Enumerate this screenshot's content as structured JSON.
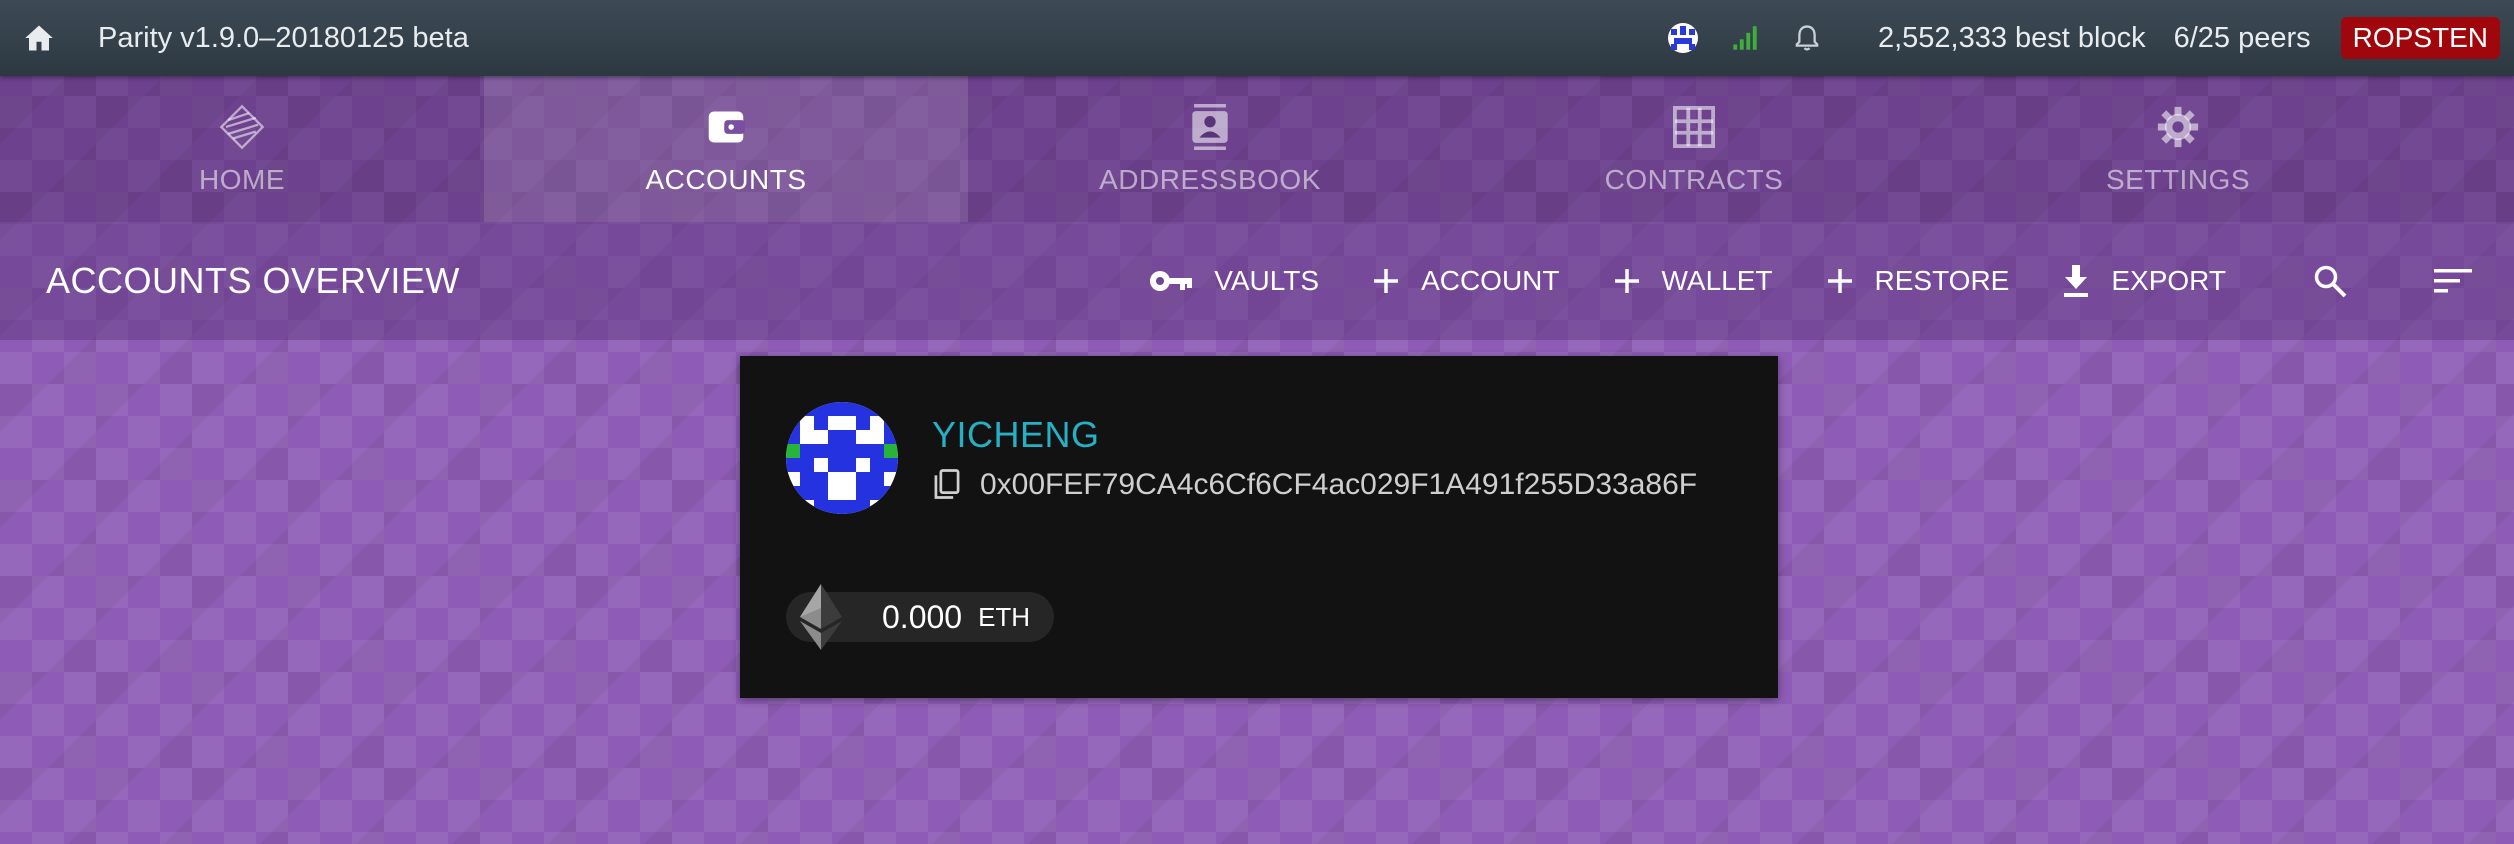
{
  "status_bar": {
    "app_title": "Parity v1.9.0–20180125 beta",
    "best_block": "2,552,333 best block",
    "peers": "6/25 peers",
    "chain": "ROPSTEN",
    "icons": [
      "home-icon",
      "identity-icon",
      "signal-icon",
      "bell-icon"
    ]
  },
  "tabs": [
    {
      "label": "HOME",
      "icon": "parity-logo-icon",
      "active": false
    },
    {
      "label": "ACCOUNTS",
      "icon": "wallet-icon",
      "active": true
    },
    {
      "label": "ADDRESSBOOK",
      "icon": "contacts-icon",
      "active": false
    },
    {
      "label": "CONTRACTS",
      "icon": "grid-icon",
      "active": false
    },
    {
      "label": "SETTINGS",
      "icon": "gear-icon",
      "active": false
    }
  ],
  "toolbar": {
    "title": "ACCOUNTS OVERVIEW",
    "vaults_label": "VAULTS",
    "account_label": "ACCOUNT",
    "wallet_label": "WALLET",
    "restore_label": "RESTORE",
    "export_label": "EXPORT"
  },
  "account": {
    "name": "YICHENG",
    "address": "0x00FEF79CA4c6Cf6CF4ac029F1A491f255D33a86F",
    "balance_value": "0.000",
    "balance_unit": "ETH"
  },
  "colors": {
    "status_bar": "#36414b",
    "chain_badge": "#a0070c",
    "background": "#8e5cb6",
    "card": "#121212",
    "account_name": "#26b0c4"
  }
}
